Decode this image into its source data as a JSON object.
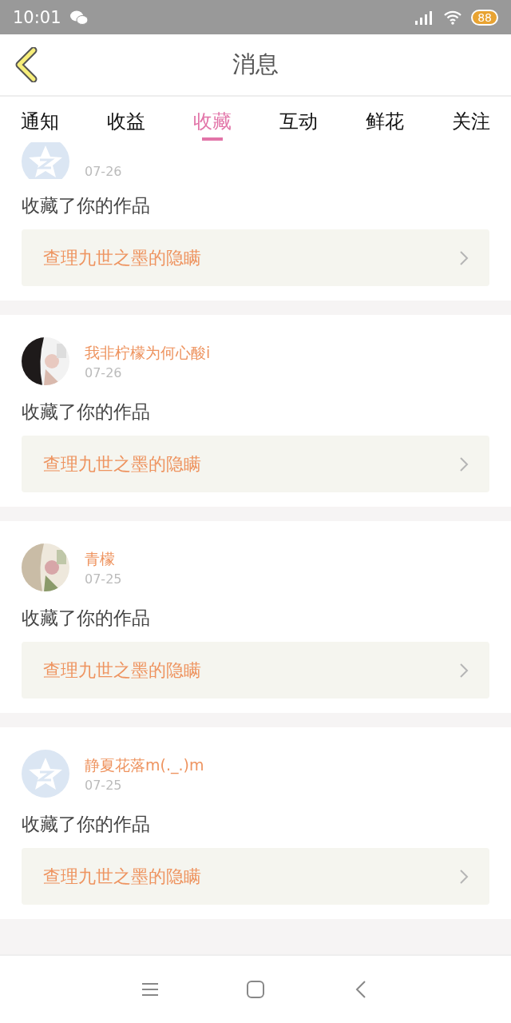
{
  "status_bar": {
    "time": "10:01",
    "battery": "88"
  },
  "header": {
    "title": "消息"
  },
  "tabs": [
    {
      "label": "通知",
      "selected": false
    },
    {
      "label": "收益",
      "selected": false
    },
    {
      "label": "收藏",
      "selected": true
    },
    {
      "label": "互动",
      "selected": false
    },
    {
      "label": "鲜花",
      "selected": false
    },
    {
      "label": "关注",
      "selected": false
    }
  ],
  "messages": [
    {
      "kind": "default",
      "date": "07-26",
      "action": "收藏了你的作品",
      "work": "查理九世之墨的隐瞒"
    },
    {
      "kind": "picture",
      "name": "我非柠檬为何心酸i",
      "date": "07-26",
      "action": "收藏了你的作品",
      "work": "查理九世之墨的隐瞒"
    },
    {
      "kind": "picture",
      "name": "青檬",
      "date": "07-25",
      "action": "收藏了你的作品",
      "work": "查理九世之墨的隐瞒"
    },
    {
      "kind": "default",
      "name": "静夏花落m(._.)m",
      "date": "07-25",
      "action": "收藏了你的作品",
      "work": "查理九世之墨的隐瞒"
    }
  ]
}
